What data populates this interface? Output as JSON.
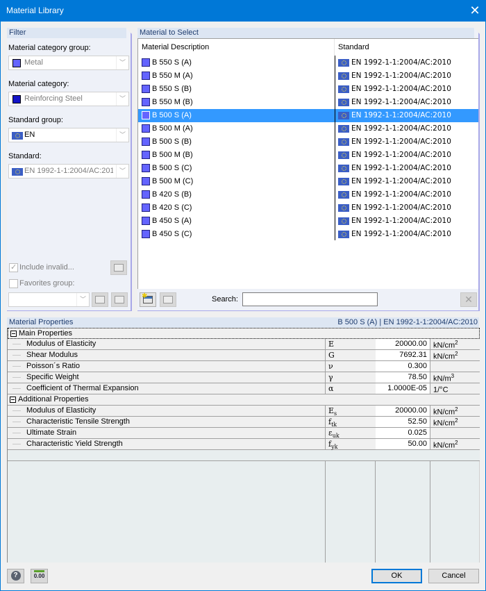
{
  "window": {
    "title": "Material Library",
    "close_icon": "close-icon"
  },
  "filter": {
    "header": "Filter",
    "category_group_label": "Material category group:",
    "category_group_value": "Metal",
    "category_group_color": "#6464ff",
    "category_label": "Material category:",
    "category_value": "Reinforcing Steel",
    "category_color": "#1414c8",
    "standard_group_label": "Standard group:",
    "standard_group_value": "EN",
    "standard_label": "Standard:",
    "standard_value": "EN 1992-1-1:2004/AC:201",
    "include_invalid_label": "Include invalid...",
    "include_invalid_checked": true,
    "favorites_label": "Favorites group:",
    "favorites_checked": false,
    "favorites_value": ""
  },
  "materials": {
    "header": "Material to Select",
    "columns": [
      "Material Description",
      "Standard"
    ],
    "selected_index": 4,
    "rows": [
      {
        "desc": "B 550 S (A)",
        "std": "EN 1992-1-1:2004/AC:2010"
      },
      {
        "desc": "B 550 M (A)",
        "std": "EN 1992-1-1:2004/AC:2010"
      },
      {
        "desc": "B 550 S (B)",
        "std": "EN 1992-1-1:2004/AC:2010"
      },
      {
        "desc": "B 550 M (B)",
        "std": "EN 1992-1-1:2004/AC:2010"
      },
      {
        "desc": "B 500 S (A)",
        "std": "EN 1992-1-1:2004/AC:2010"
      },
      {
        "desc": "B 500 M (A)",
        "std": "EN 1992-1-1:2004/AC:2010"
      },
      {
        "desc": "B 500 S (B)",
        "std": "EN 1992-1-1:2004/AC:2010"
      },
      {
        "desc": "B 500 M (B)",
        "std": "EN 1992-1-1:2004/AC:2010"
      },
      {
        "desc": "B 500 S (C)",
        "std": "EN 1992-1-1:2004/AC:2010"
      },
      {
        "desc": "B 500 M (C)",
        "std": "EN 1992-1-1:2004/AC:2010"
      },
      {
        "desc": "B 420 S (B)",
        "std": "EN 1992-1-1:2004/AC:2010"
      },
      {
        "desc": "B 420 S (C)",
        "std": "EN 1992-1-1:2004/AC:2010"
      },
      {
        "desc": "B 450 S (A)",
        "std": "EN 1992-1-1:2004/AC:2010"
      },
      {
        "desc": "B 450 S (C)",
        "std": "EN 1992-1-1:2004/AC:2010"
      }
    ],
    "search_label": "Search:",
    "search_value": ""
  },
  "properties": {
    "header": "Material Properties",
    "selection_summary": "B 500 S (A)  |  EN 1992-1-1:2004/AC:2010",
    "groups": [
      {
        "name": "Main Properties",
        "items": [
          {
            "name": "Modulus of Elasticity",
            "sym": "E",
            "sub": "",
            "value": "20000.00",
            "unit": "kN/cm",
            "sup": "2"
          },
          {
            "name": "Shear Modulus",
            "sym": "G",
            "sub": "",
            "value": "7692.31",
            "unit": "kN/cm",
            "sup": "2"
          },
          {
            "name": "Poisson´s Ratio",
            "sym": "ν",
            "sub": "",
            "value": "0.300",
            "unit": "",
            "sup": ""
          },
          {
            "name": "Specific Weight",
            "sym": "γ",
            "sub": "",
            "value": "78.50",
            "unit": "kN/m",
            "sup": "3"
          },
          {
            "name": "Coefficient of Thermal Expansion",
            "sym": "α",
            "sub": "",
            "value": "1.0000E-05",
            "unit": "1/°C",
            "sup": ""
          }
        ]
      },
      {
        "name": "Additional Properties",
        "items": [
          {
            "name": "Modulus of Elasticity",
            "sym": "E",
            "sub": "s",
            "value": "20000.00",
            "unit": "kN/cm",
            "sup": "2"
          },
          {
            "name": "Characteristic Tensile Strength",
            "sym": "f",
            "sub": "tk",
            "value": "52.50",
            "unit": "kN/cm",
            "sup": "2"
          },
          {
            "name": "Ultimate Strain",
            "sym": "ε",
            "sub": "uk",
            "value": "0.025",
            "unit": "",
            "sup": ""
          },
          {
            "name": "Characteristic Yield Strength",
            "sym": "f",
            "sub": "yk",
            "value": "50.00",
            "unit": "kN/cm",
            "sup": "2"
          }
        ]
      }
    ]
  },
  "footer": {
    "help_icon": "help-icon",
    "units_icon": "units-decimal-icon",
    "units_glyph": "0.00",
    "help_glyph": "?",
    "ok_label": "OK",
    "cancel_label": "Cancel"
  }
}
